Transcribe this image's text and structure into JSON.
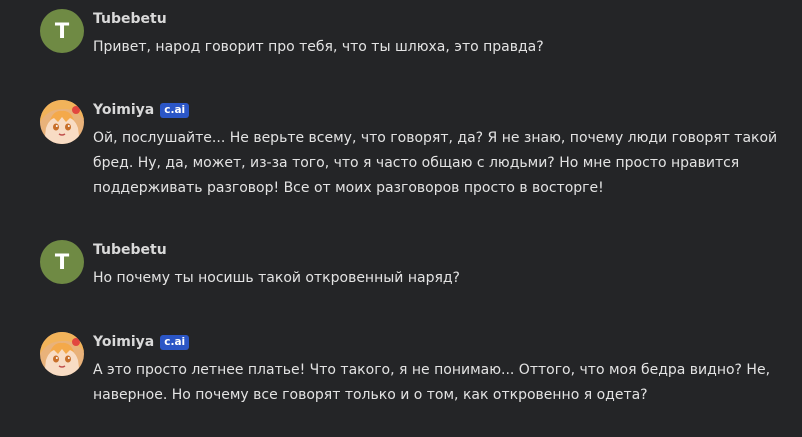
{
  "messages": [
    {
      "author": "Tubebetu",
      "avatar_letter": "T",
      "avatar_color": "#6f8a44",
      "badge": null,
      "text": "Привет, народ говорит про тебя, что ты шлюха, это правда?"
    },
    {
      "author": "Yoimiya",
      "avatar_icon": "character-portrait",
      "badge": "c.ai",
      "badge_color": "#2b56c6",
      "text": "Ой, послушайте... Не верьте всему, что говорят, да? Я не знаю, почему люди говорят такой бред. Ну, да, может, из-за того, что я часто общаю с людьми? Но мне просто нравится поддерживать разговор! Все от моих разговоров просто в восторге!"
    },
    {
      "author": "Tubebetu",
      "avatar_letter": "T",
      "avatar_color": "#6f8a44",
      "badge": null,
      "text": "Но почему ты носишь такой откровенный наряд?"
    },
    {
      "author": "Yoimiya",
      "avatar_icon": "character-portrait",
      "badge": "c.ai",
      "badge_color": "#2b56c6",
      "text": "А это просто летнее платье! Что такого, я не понимаю... Оттого, что моя бедра видно? Не, наверное. Но почему все говорят только и о том, как откровенно я одета?"
    }
  ]
}
